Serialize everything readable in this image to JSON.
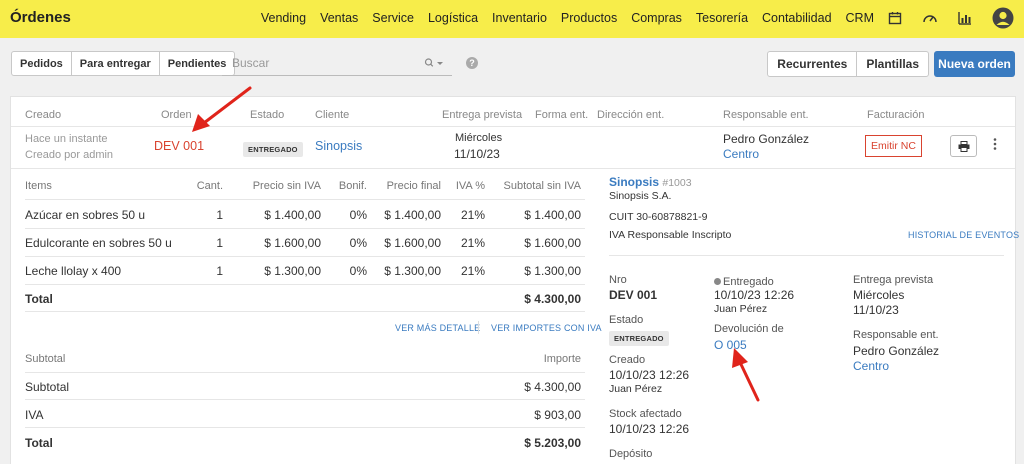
{
  "app": {
    "title": "Órdenes",
    "nav": [
      "Vending",
      "Ventas",
      "Service",
      "Logística",
      "Inventario",
      "Productos",
      "Compras",
      "Tesorería",
      "Contabilidad",
      "CRM"
    ],
    "icons": [
      "calendar-icon",
      "gauge-icon",
      "bar-chart-icon",
      "user-avatar-icon"
    ],
    "accent": "#f7ed4a"
  },
  "toolbar": {
    "filters": [
      "Pedidos",
      "Para entregar",
      "Pendientes"
    ],
    "search_placeholder": "Buscar",
    "help": "?",
    "right_buttons": [
      "Recurrentes",
      "Plantillas"
    ],
    "primary_button": "Nueva orden",
    "primary_color": "#3a7bc0"
  },
  "order_list": {
    "headers": {
      "creado": "Creado",
      "orden": "Orden",
      "estado": "Estado",
      "cliente": "Cliente",
      "entrega": "Entrega prevista",
      "forma": "Forma ent.",
      "direccion": "Dirección ent.",
      "responsable": "Responsable ent.",
      "facturacion": "Facturación"
    },
    "row": {
      "created": "Hace un instante",
      "created_by": "Creado por admin",
      "order": "DEV 001",
      "status": "ENTREGADO",
      "client": "Sinopsis",
      "delivery_day": "Miércoles",
      "delivery_date": "11/10/23",
      "responsible": "Pedro González",
      "responsible_branch": "Centro",
      "billing_button": "Emitir NC",
      "order_color": "#d9432f"
    }
  },
  "items": {
    "headers": {
      "items": "Items",
      "cant": "Cant.",
      "precio": "Precio sin IVA",
      "bonif": "Bonif.",
      "final": "Precio final",
      "iva": "IVA %",
      "subtotal": "Subtotal sin IVA"
    },
    "rows": [
      {
        "name": "Azúcar en sobres 50 u",
        "qty": "1",
        "price": "$ 1.400,00",
        "bonif": "0%",
        "final": "$ 1.400,00",
        "iva": "21%",
        "subtotal": "$ 1.400,00"
      },
      {
        "name": "Edulcorante en sobres 50 u",
        "qty": "1",
        "price": "$ 1.600,00",
        "bonif": "0%",
        "final": "$ 1.600,00",
        "iva": "21%",
        "subtotal": "$ 1.600,00"
      },
      {
        "name": "Leche llolay x 400",
        "qty": "1",
        "price": "$ 1.300,00",
        "bonif": "0%",
        "final": "$ 1.300,00",
        "iva": "21%",
        "subtotal": "$ 1.300,00"
      }
    ],
    "total_label": "Total",
    "total_value": "$ 4.300,00",
    "link_detail": "VER MÁS DETALLE",
    "link_iva": "VER IMPORTES CON IVA"
  },
  "summary": {
    "header_label": "Subtotal",
    "header_amount": "Importe",
    "rows": [
      {
        "label": "Subtotal",
        "value": "$ 4.300,00"
      },
      {
        "label": "IVA",
        "value": "$ 903,00"
      }
    ],
    "total_label": "Total",
    "total_value": "$ 5.203,00"
  },
  "client_panel": {
    "name": "Sinopsis",
    "number": "#1003",
    "legal_name": "Sinopsis S.A.",
    "cuit": "CUIT 30-60878821-9",
    "iva": "IVA Responsable Inscripto",
    "history_link": "HISTORIAL DE EVENTOS",
    "nro_label": "Nro",
    "nro_value": "DEV 001",
    "estado_label": "Estado",
    "estado_value": "ENTREGADO",
    "creado_label": "Creado",
    "creado_value": "10/10/23 12:26",
    "creado_by": "Juan Pérez",
    "stock_label": "Stock afectado",
    "stock_value": "10/10/23 12:26",
    "deposito_label": "Depósito",
    "entregado_label": "Entregado",
    "entregado_value": "10/10/23 12:26",
    "entregado_by": "Juan Pérez",
    "devolucion_label": "Devolución de",
    "devolucion_value": "O 005",
    "entrega_label": "Entrega prevista",
    "entrega_day": "Miércoles",
    "entrega_date": "11/10/23",
    "responsable_label": "Responsable ent.",
    "responsable_value": "Pedro González",
    "responsable_branch": "Centro"
  }
}
